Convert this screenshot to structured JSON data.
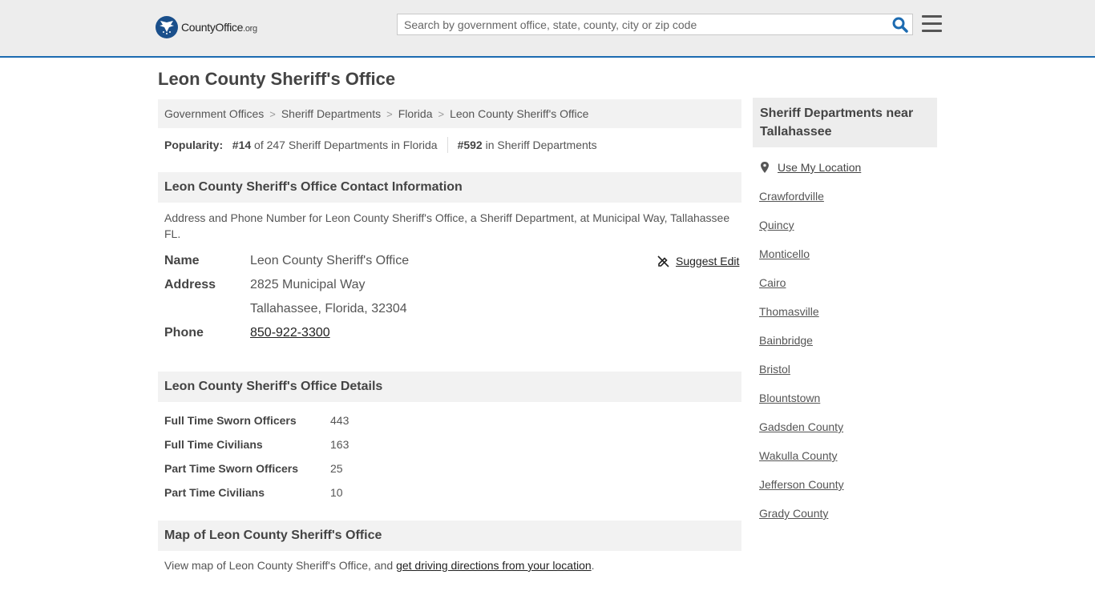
{
  "header": {
    "logo_main": "CountyOffice",
    "logo_suffix": ".org",
    "search_placeholder": "Search by government office, state, county, city or zip code"
  },
  "page_title": "Leon County Sheriff's Office",
  "breadcrumb": [
    "Government Offices",
    "Sheriff Departments",
    "Florida",
    "Leon County Sheriff's Office"
  ],
  "popularity": {
    "label": "Popularity:",
    "state_rank": "#14",
    "state_text": "of 247 Sheriff Departments in Florida",
    "national_rank": "#592",
    "national_text": "in Sheriff Departments"
  },
  "contact": {
    "heading": "Leon County Sheriff's Office Contact Information",
    "description": "Address and Phone Number for Leon County Sheriff's Office, a Sheriff Department, at Municipal Way, Tallahassee FL.",
    "name_label": "Name",
    "name": "Leon County Sheriff's Office",
    "address_label": "Address",
    "address_line1": "2825 Municipal Way",
    "address_line2": "Tallahassee, Florida, 32304",
    "phone_label": "Phone",
    "phone": "850-922-3300",
    "suggest_edit": "Suggest Edit"
  },
  "details": {
    "heading": "Leon County Sheriff's Office Details",
    "rows": [
      {
        "label": "Full Time Sworn Officers",
        "value": "443"
      },
      {
        "label": "Full Time Civilians",
        "value": "163"
      },
      {
        "label": "Part Time Sworn Officers",
        "value": "25"
      },
      {
        "label": "Part Time Civilians",
        "value": "10"
      }
    ]
  },
  "map": {
    "heading": "Map of Leon County Sheriff's Office",
    "text_prefix": "View map of Leon County Sheriff's Office, and",
    "link": "get driving directions from your location",
    "text_suffix": "."
  },
  "sidebar": {
    "heading": "Sheriff Departments near Tallahassee",
    "use_location": "Use My Location",
    "nearby": [
      "Crawfordville",
      "Quincy",
      "Monticello",
      "Cairo",
      "Thomasville",
      "Bainbridge",
      "Bristol",
      "Blountstown",
      "Gadsden County",
      "Wakulla County",
      "Jefferson County",
      "Grady County"
    ]
  },
  "colors": {
    "accent": "#1c6bb1",
    "header_bg": "#ededed",
    "section_bg": "#f2f2f2"
  }
}
